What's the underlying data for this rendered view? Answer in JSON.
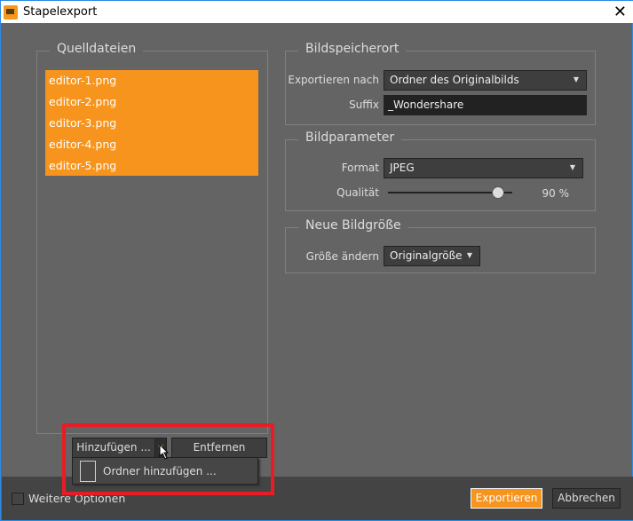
{
  "window": {
    "title": "Stapelexport",
    "close_icon": "close-icon"
  },
  "source": {
    "legend": "Quelldateien",
    "files": [
      "editor-1.png",
      "editor-2.png",
      "editor-3.png",
      "editor-4.png",
      "editor-5.png"
    ],
    "add_label": "Hinzufügen ...",
    "remove_label": "Entfernen",
    "add_menu": {
      "add_folder": "Ordner hinzufügen ..."
    }
  },
  "location": {
    "legend": "Bildspeicherort",
    "export_to_label": "Exportieren nach",
    "export_to_value": "Ordner des Originalbilds",
    "suffix_label": "Suffix",
    "suffix_value": "_Wondershare"
  },
  "params": {
    "legend": "Bildparameter",
    "format_label": "Format",
    "format_value": "JPEG",
    "quality_label": "Qualität",
    "quality_value": "90 %",
    "quality_percent": 90
  },
  "resize": {
    "legend": "Neue Bildgröße",
    "resize_label": "Größe ändern",
    "resize_value": "Originalgröße"
  },
  "footer": {
    "more_options": "Weitere Optionen",
    "export": "Exportieren",
    "cancel": "Abbrechen"
  },
  "colors": {
    "accent": "#f7941d",
    "highlight": "#e81c24"
  }
}
